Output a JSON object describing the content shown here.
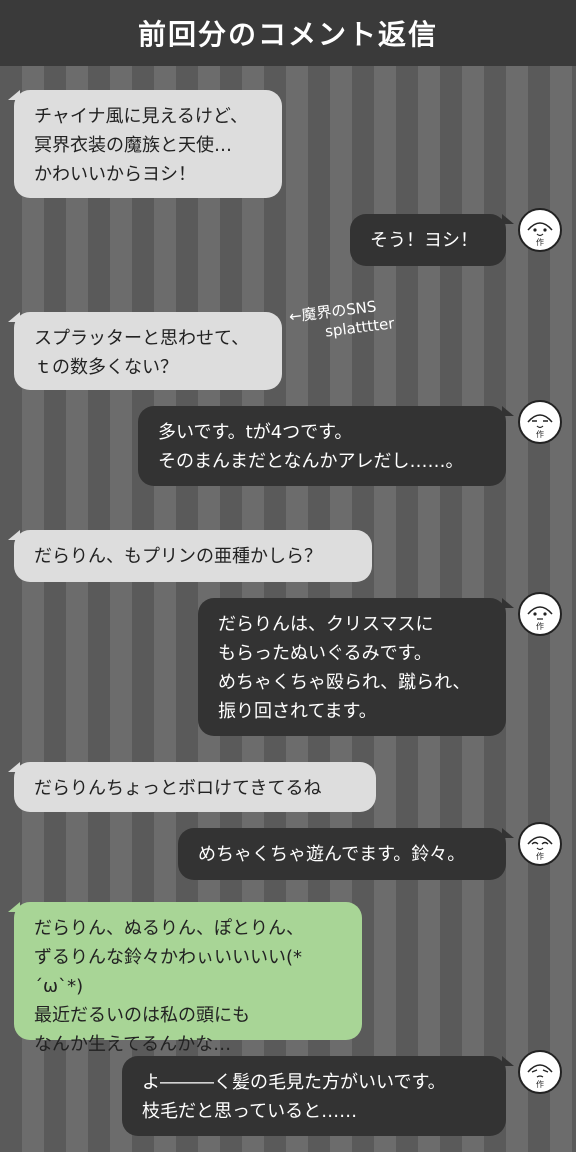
{
  "header": {
    "title": "前回分のコメント返信"
  },
  "messages": [
    {
      "side": "left",
      "text": "チャイナ風に見えるけど、\n冥界衣装の魔族と天使…\nかわいいからヨシ！"
    },
    {
      "side": "right",
      "text": "そう！ヨシ！"
    },
    {
      "side": "left",
      "text": "スプラッターと思わせて、\nｔの数多くない？"
    },
    {
      "side": "right",
      "text": "多いです。tが4つです。\nそのまんまだとなんかアレだし……。"
    },
    {
      "side": "left",
      "text": "だらりん、もプリンの亜種かしら？"
    },
    {
      "side": "right",
      "text": "だらりんは、クリスマスに\nもらったぬいぐるみです。\nめちゃくちゃ殴られ、蹴られ、\n振り回されてます。"
    },
    {
      "side": "left",
      "text": "だらりんちょっとボロけてきてるね"
    },
    {
      "side": "right",
      "text": "めちゃくちゃ遊んでます。鈴々。"
    },
    {
      "side": "left",
      "text": "だらりん、ぬるりん、ぽとりん、\nずるりんな鈴々かわぃいいいい(*´ω`*)\n最近だるいのは私の頭にも\nなんか生えてるんかな…"
    },
    {
      "side": "right",
      "text": "よ―――く髪の毛見た方がいいです。\n枝毛だと思っていると……"
    }
  ],
  "note": {
    "line1": "←魔界のSNS",
    "line2": "splatttter"
  },
  "avatar_label": "作",
  "colors": {
    "header": "#3a3a3a",
    "left_bubble": "#dddddd",
    "right_bubble": "#333333",
    "highlight_bubble": "#a8d596"
  }
}
